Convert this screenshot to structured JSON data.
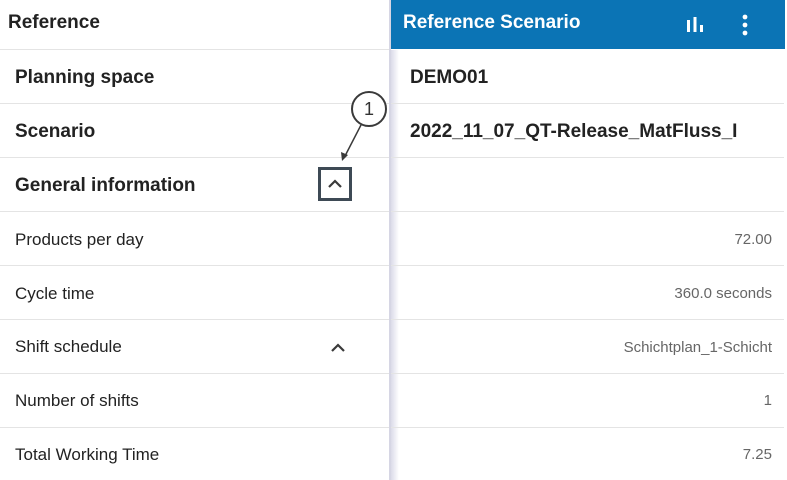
{
  "left_header": {
    "title": "Reference"
  },
  "right_header": {
    "title": "Reference Scenario",
    "icons": [
      "bar-chart-icon",
      "more-vertical-icon"
    ],
    "background_color": "#0b74b5"
  },
  "rows": [
    {
      "label": "Planning space",
      "value": "DEMO01"
    },
    {
      "label": "Scenario",
      "value": "2022_11_07_QT-Release_MatFluss_I"
    },
    {
      "label": "General information",
      "value": ""
    },
    {
      "label": "Products per day",
      "value": "72.00"
    },
    {
      "label": "Cycle time",
      "value": "360.0 seconds"
    },
    {
      "label": "Shift schedule",
      "value": "Schichtplan_1-Schicht"
    },
    {
      "label": "Number of shifts",
      "value": "1"
    },
    {
      "label": "Total Working Time",
      "value": "7.25"
    }
  ],
  "callout": {
    "number": "1"
  }
}
